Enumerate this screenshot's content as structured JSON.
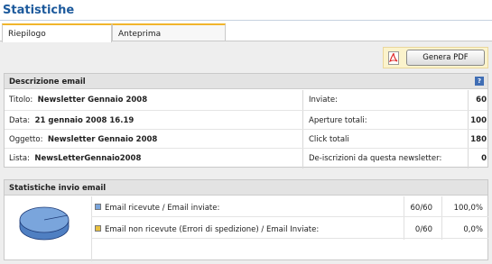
{
  "page": {
    "title": "Statistiche"
  },
  "tabs": [
    {
      "label": "Riepilogo",
      "active": true
    },
    {
      "label": "Anteprima",
      "active": false
    }
  ],
  "toolbar": {
    "pdf_button_label": "Genera PDF",
    "pdf_icon": "pdf-icon"
  },
  "description": {
    "header": "Descrizione email",
    "help_icon": "help-icon",
    "fields": [
      {
        "label": "Titolo:",
        "value": "Newsletter Gennaio 2008"
      },
      {
        "label": "Data:",
        "value": "21 gennaio 2008 16.19"
      },
      {
        "label": "Oggetto:",
        "value": "Newsletter Gennaio 2008"
      },
      {
        "label": "Lista:",
        "value": "NewsLetterGennaio2008"
      }
    ],
    "counters": [
      {
        "label": "Inviate:",
        "value": "60"
      },
      {
        "label": "Aperture totali:",
        "value": "100"
      },
      {
        "label": "Click totali",
        "value": "180"
      },
      {
        "label": "De-iscrizioni da questa newsletter:",
        "value": "0"
      }
    ]
  },
  "stats": {
    "header": "Statistiche invio email",
    "rows": [
      {
        "label": "Email ricevute / Email inviate:",
        "ratio": "60/60",
        "percent": "100,0%",
        "color": "#7aa5dc"
      },
      {
        "label": "Email non ricevute (Errori di spedizione) / Email Inviate:",
        "ratio": "0/60",
        "percent": "0,0%",
        "color": "#e8c040"
      }
    ],
    "pie_colors": {
      "received": "#7aa5dc",
      "edge": "#1f3c78"
    }
  }
}
